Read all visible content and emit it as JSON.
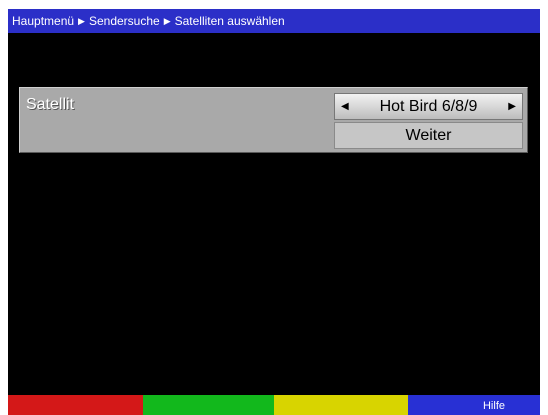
{
  "breadcrumb": [
    "Hauptmenü",
    "Sendersuche",
    "Satelliten auswählen"
  ],
  "satellite": {
    "label": "Satellit",
    "selected_value": "Hot Bird 6/8/9",
    "next_label": "Weiter"
  },
  "color_keys": {
    "red": "",
    "green": "",
    "yellow": "",
    "blue": "Hilfe"
  },
  "colors": {
    "title_bar": "#2b2fc8",
    "panel": "#a9a9a9",
    "red_key": "#d41818",
    "green_key": "#12b81c",
    "yellow_key": "#d8d400",
    "blue_key": "#2830d4"
  }
}
